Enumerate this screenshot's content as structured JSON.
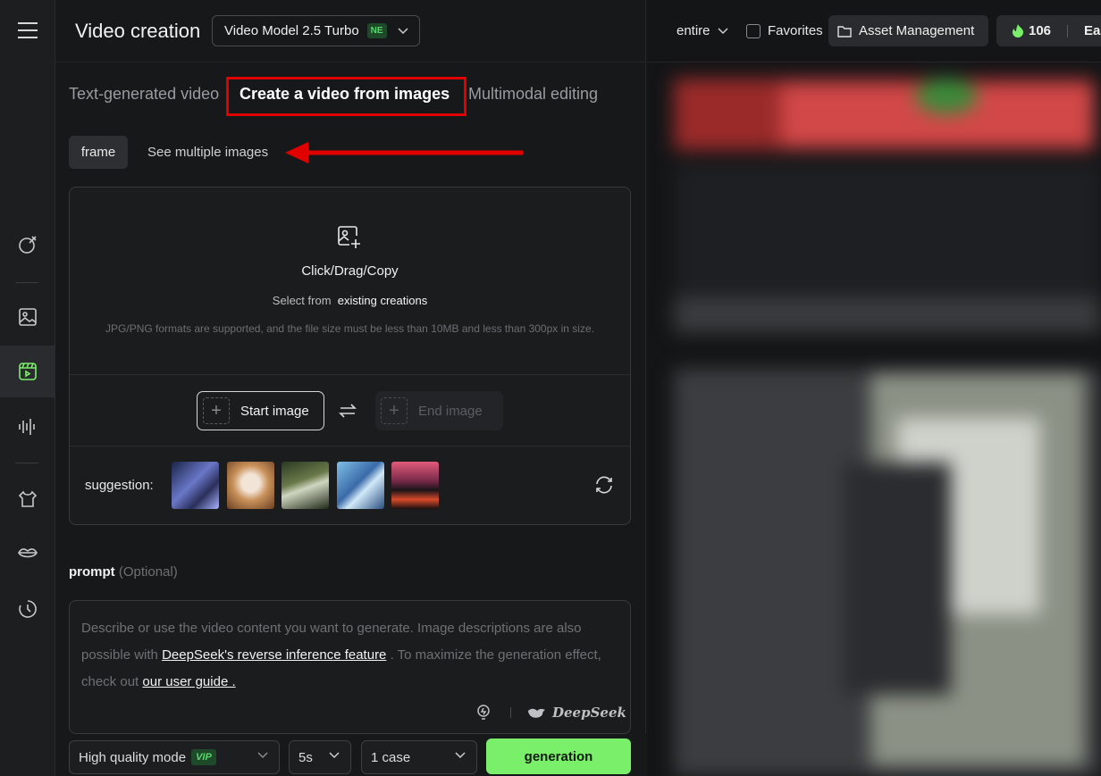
{
  "header": {
    "title": "Video creation",
    "model": "Video Model 2.5 Turbo",
    "model_badge": "NE"
  },
  "tabs": [
    {
      "label": "Text-generated video"
    },
    {
      "label": "Create a video from images"
    },
    {
      "label": "Multimodal editing"
    }
  ],
  "subtabs": [
    {
      "label": "frame"
    },
    {
      "label": "See multiple images"
    }
  ],
  "upload": {
    "title": "Click/Drag/Copy",
    "select_prefix": "Select from",
    "select_link": "existing creations",
    "hint": "JPG/PNG formats are supported, and the file size must be less than 10MB and less than 300px in size.",
    "start_image": "Start image",
    "end_image": "End image",
    "suggestion_label": "suggestion:"
  },
  "prompt": {
    "label": "prompt",
    "optional": "(Optional)",
    "text_1": "Describe or use the video content you want to generate. Image descriptions are also possible with",
    "link_1": "DeepSeek's reverse inference feature",
    "text_2": ". To maximize the generation effect, check out",
    "link_2": "our user guide .",
    "brand": "DeepSeek"
  },
  "bottom": {
    "mode": "High quality mode",
    "vip": "VIP",
    "duration": "5s",
    "count": "1 case",
    "generate": "generation"
  },
  "right": {
    "filter": "entire",
    "favorites": "Favorites",
    "asset": "Asset Management",
    "points": "106",
    "earn": "Ea"
  },
  "colors": {
    "accent": "#7af06a",
    "highlight": "#e00000"
  }
}
